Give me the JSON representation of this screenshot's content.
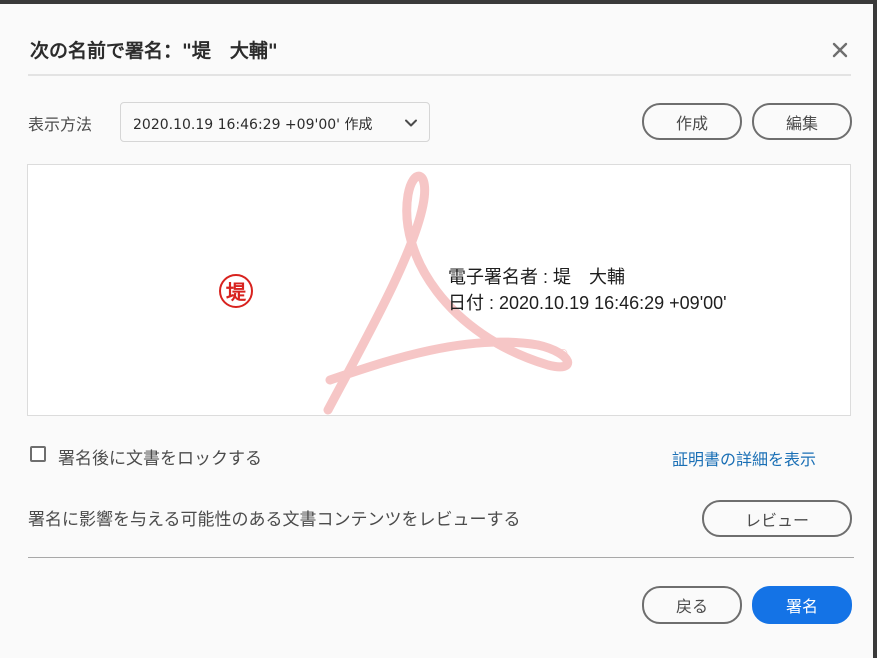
{
  "dialog": {
    "title": "次の名前で署名：\"堤　大輔\"",
    "close_icon": "close-icon"
  },
  "appearance": {
    "label": "表示方法",
    "selected": "2020.10.19 16:46:29 +09'00' 作成",
    "create_label": "作成",
    "edit_label": "編集"
  },
  "preview": {
    "seal_char": "堤",
    "signer_line": "電子署名者 : 堤　大輔",
    "date_line": "日付 : 2020.10.19 16:46:29 +09'00'",
    "registered_mark": "®",
    "seal_color": "#d8231f",
    "watermark_color": "#f6c6c6"
  },
  "options": {
    "lock_label": "署名後に文書をロックする",
    "lock_checked": false,
    "cert_details_link": "証明書の詳細を表示",
    "review_text": "署名に影響を与える可能性のある文書コンテンツをレビューする",
    "review_button": "レビュー"
  },
  "footer": {
    "back_label": "戻る",
    "sign_label": "署名",
    "accent": "#1473e6"
  }
}
